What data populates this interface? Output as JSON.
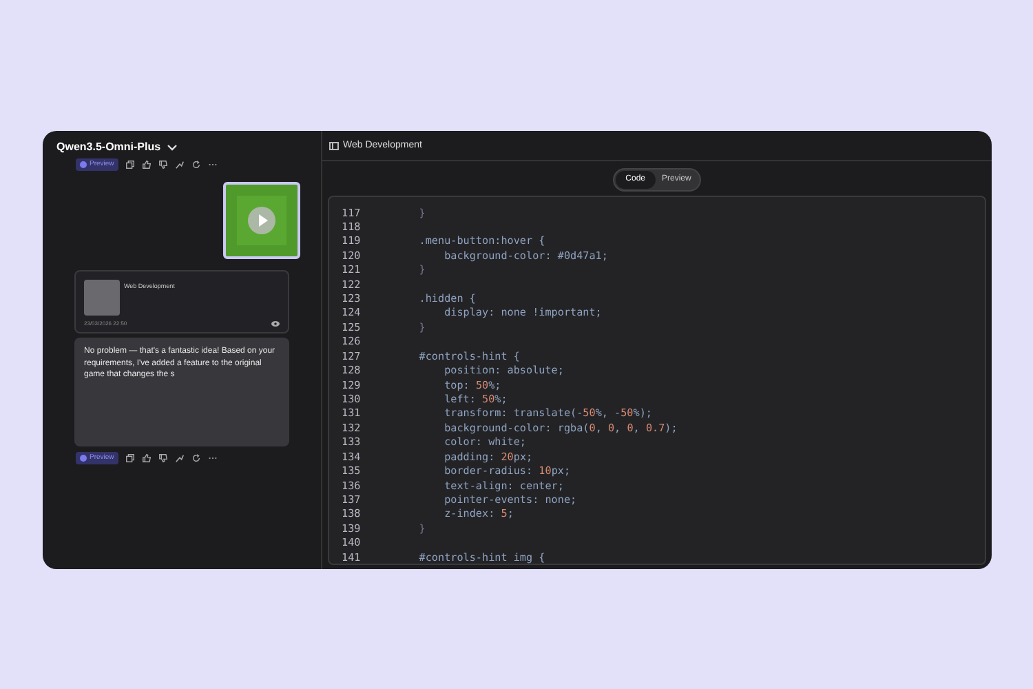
{
  "sidebar": {
    "model_name": "Qwen3.5-Omni-Plus",
    "top_actions": {
      "preview_label": "Preview"
    },
    "artifact_card": {
      "title": "Web Development",
      "timestamp": "23/03/2026 22:50"
    },
    "message": "No problem — that's a fantastic idea! Based on your requirements, I've added a feature to the original game that changes the s",
    "bottom_actions": {
      "preview_label": "Preview"
    }
  },
  "panel": {
    "title": "Web Development",
    "tabs": [
      {
        "label": "Code",
        "selected": true
      },
      {
        "label": "Preview",
        "selected": false
      }
    ],
    "code_lines": [
      {
        "number": "117",
        "segments": [
          {
            "kind": "punct",
            "text": "    }"
          }
        ]
      },
      {
        "number": "118"
      },
      {
        "number": "119",
        "segments": [
          {
            "kind": "text",
            "text": "    .menu-button:hover {"
          }
        ]
      },
      {
        "number": "120",
        "segments": [
          {
            "kind": "text",
            "text": "        background-color: #0d47a1;"
          }
        ]
      },
      {
        "number": "121",
        "segments": [
          {
            "kind": "punct",
            "text": "    }"
          }
        ]
      },
      {
        "number": "122"
      },
      {
        "number": "123",
        "segments": [
          {
            "kind": "text",
            "text": "    .hidden {"
          }
        ]
      },
      {
        "number": "124",
        "segments": [
          {
            "kind": "text",
            "text": "        display: none !important;"
          }
        ]
      },
      {
        "number": "125",
        "segments": [
          {
            "kind": "punct",
            "text": "    }"
          }
        ]
      },
      {
        "number": "126"
      },
      {
        "number": "127",
        "segments": [
          {
            "kind": "text",
            "text": "    #controls-hint {"
          }
        ]
      },
      {
        "number": "128",
        "segments": [
          {
            "kind": "text",
            "text": "        position: absolute;"
          }
        ]
      },
      {
        "number": "129",
        "segments": [
          {
            "kind": "text",
            "text": "        top: "
          },
          {
            "kind": "number",
            "text": "50"
          },
          {
            "kind": "text",
            "text": "%;"
          }
        ]
      },
      {
        "number": "130",
        "segments": [
          {
            "kind": "text",
            "text": "        left: "
          },
          {
            "kind": "number",
            "text": "50"
          },
          {
            "kind": "text",
            "text": "%;"
          }
        ]
      },
      {
        "number": "131",
        "segments": [
          {
            "kind": "text",
            "text": "        transform: translate(-"
          },
          {
            "kind": "number",
            "text": "50"
          },
          {
            "kind": "text",
            "text": "%, -"
          },
          {
            "kind": "number",
            "text": "50"
          },
          {
            "kind": "text",
            "text": "%);"
          }
        ]
      },
      {
        "number": "132",
        "segments": [
          {
            "kind": "text",
            "text": "        background-color: rgba("
          },
          {
            "kind": "number",
            "text": "0"
          },
          {
            "kind": "text",
            "text": ", "
          },
          {
            "kind": "number",
            "text": "0"
          },
          {
            "kind": "text",
            "text": ", "
          },
          {
            "kind": "number",
            "text": "0"
          },
          {
            "kind": "text",
            "text": ", "
          },
          {
            "kind": "number",
            "text": "0.7"
          },
          {
            "kind": "text",
            "text": ");"
          }
        ]
      },
      {
        "number": "133",
        "segments": [
          {
            "kind": "text",
            "text": "        color: white;"
          }
        ]
      },
      {
        "number": "134",
        "segments": [
          {
            "kind": "text",
            "text": "        padding: "
          },
          {
            "kind": "number",
            "text": "20"
          },
          {
            "kind": "text",
            "text": "px;"
          }
        ]
      },
      {
        "number": "135",
        "segments": [
          {
            "kind": "text",
            "text": "        border-radius: "
          },
          {
            "kind": "number",
            "text": "10"
          },
          {
            "kind": "text",
            "text": "px;"
          }
        ]
      },
      {
        "number": "136",
        "segments": [
          {
            "kind": "text",
            "text": "        text-align: center;"
          }
        ]
      },
      {
        "number": "137",
        "segments": [
          {
            "kind": "text",
            "text": "        pointer-events: none;"
          }
        ]
      },
      {
        "number": "138",
        "segments": [
          {
            "kind": "text",
            "text": "        z-index: "
          },
          {
            "kind": "number",
            "text": "5"
          },
          {
            "kind": "text",
            "text": ";"
          }
        ]
      },
      {
        "number": "139",
        "segments": [
          {
            "kind": "punct",
            "text": "    }"
          }
        ]
      },
      {
        "number": "140"
      },
      {
        "number": "141",
        "segments": [
          {
            "kind": "text",
            "text": "    #controls-hint img {"
          }
        ]
      }
    ]
  }
}
